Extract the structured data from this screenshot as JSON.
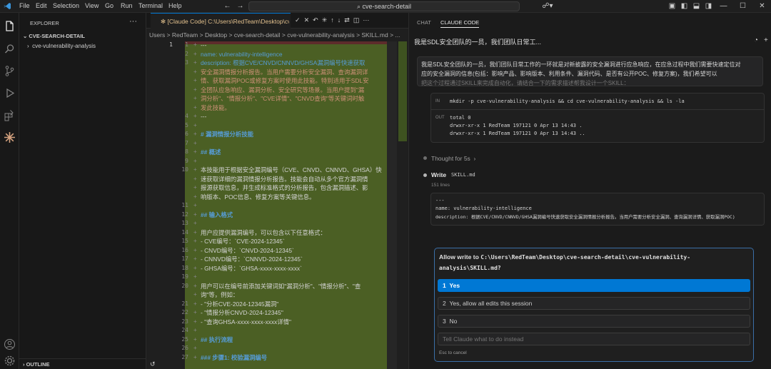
{
  "titlebar": {
    "menus": [
      "File",
      "Edit",
      "Selection",
      "View",
      "Go",
      "Run",
      "Terminal",
      "Help"
    ],
    "search": "cve-search-detail"
  },
  "sidebar": {
    "header": "EXPLORER",
    "root": "CVE-SEARCH-DETAIL",
    "folder": "cve-vulnerability-analysis",
    "outline": "OUTLINE"
  },
  "editor": {
    "tab_title": "✻ [Claude Code] C:\\Users\\RedTeam\\Desktop\\cve",
    "breadcrumb": "Users > RedTeam > Desktop > cve-search-detail > cve-vulnerability-analysis > SKILL.md > ...",
    "lines": [
      {
        "old": "1",
        "new": "1",
        "cls": "dash",
        "text": "---"
      },
      {
        "old": "",
        "new": "2",
        "cls": "meta",
        "text": "name: vulnerability-intelligence"
      },
      {
        "old": "",
        "new": "3",
        "cls": "meta",
        "text": "description: 根据CVE/CNVD/CNNVD/GHSA漏洞编号快速获取"
      },
      {
        "old": "",
        "new": "",
        "cls": "val",
        "text": "安全漏洞情报分析报告。当用户需要分析安全漏洞、查询漏洞详"
      },
      {
        "old": "",
        "new": "",
        "cls": "val",
        "text": "情、获取漏洞POC或修复方案时使用此技能。特别适用于SDL安"
      },
      {
        "old": "",
        "new": "",
        "cls": "val",
        "text": "全团队应急响应、漏洞分析、安全研究等场景。当用户提到\"漏"
      },
      {
        "old": "",
        "new": "",
        "cls": "val",
        "text": "洞分析\"、\"情报分析\"、\"CVE详情\"、\"CNVD查询\"等关键词时触"
      },
      {
        "old": "",
        "new": "",
        "cls": "val",
        "text": "发此技能。"
      },
      {
        "old": "",
        "new": "4",
        "cls": "dash",
        "text": "---"
      },
      {
        "old": "",
        "new": "5",
        "cls": "txt",
        "text": ""
      },
      {
        "old": "",
        "new": "6",
        "cls": "head",
        "text": "# 漏洞情报分析技能"
      },
      {
        "old": "",
        "new": "7",
        "cls": "txt",
        "text": ""
      },
      {
        "old": "",
        "new": "8",
        "cls": "head",
        "text": "## 概述"
      },
      {
        "old": "",
        "new": "9",
        "cls": "txt",
        "text": ""
      },
      {
        "old": "",
        "new": "10",
        "cls": "txt",
        "text": "本技能用于根据安全漏洞编号（CVE、CNVD、CNNVD、GHSA）快"
      },
      {
        "old": "",
        "new": "",
        "cls": "txt",
        "text": "速获取详细的漏洞情报分析报告。技能会自动从多个官方漏洞情"
      },
      {
        "old": "",
        "new": "",
        "cls": "txt",
        "text": "报源获取信息，并生成标准格式的分析报告，包含漏洞描述、影"
      },
      {
        "old": "",
        "new": "",
        "cls": "txt",
        "text": "响版本、POC信息、修复方案等关键信息。"
      },
      {
        "old": "",
        "new": "11",
        "cls": "txt",
        "text": ""
      },
      {
        "old": "",
        "new": "12",
        "cls": "head",
        "text": "## 输入格式"
      },
      {
        "old": "",
        "new": "13",
        "cls": "txt",
        "text": ""
      },
      {
        "old": "",
        "new": "14",
        "cls": "txt",
        "text": "用户应提供漏洞编号，可以包含以下任意格式："
      },
      {
        "old": "",
        "new": "15",
        "cls": "txt",
        "text": "- CVE编号：`CVE-2024-12345`"
      },
      {
        "old": "",
        "new": "16",
        "cls": "txt",
        "text": "- CNVD编号：`CNVD-2024-12345`"
      },
      {
        "old": "",
        "new": "17",
        "cls": "txt",
        "text": "- CNNVD编号：`CNNVD-2024-12345`"
      },
      {
        "old": "",
        "new": "18",
        "cls": "txt",
        "text": "- GHSA编号：`GHSA-xxxx-xxxx-xxxx`"
      },
      {
        "old": "",
        "new": "19",
        "cls": "txt",
        "text": ""
      },
      {
        "old": "",
        "new": "20",
        "cls": "txt",
        "text": "用户可以在编号前添加关键词如\"漏洞分析\"、\"情报分析\"、\"查"
      },
      {
        "old": "",
        "new": "",
        "cls": "txt",
        "text": "询\"等，例如："
      },
      {
        "old": "",
        "new": "21",
        "cls": "txt",
        "text": "- \"分析CVE-2024-12345漏洞\""
      },
      {
        "old": "",
        "new": "22",
        "cls": "txt",
        "text": "- \"情报分析CNVD-2024-12345\""
      },
      {
        "old": "",
        "new": "23",
        "cls": "txt",
        "text": "- \"查询GHSA-xxxx-xxxx-xxxx详情\""
      },
      {
        "old": "",
        "new": "24",
        "cls": "txt",
        "text": ""
      },
      {
        "old": "",
        "new": "25",
        "cls": "head",
        "text": "## 执行流程"
      },
      {
        "old": "",
        "new": "26",
        "cls": "txt",
        "text": ""
      },
      {
        "old": "",
        "new": "27",
        "cls": "head",
        "text": "### 步骤1: 校验漏洞编号"
      }
    ]
  },
  "panel": {
    "tab_chat": "CHAT",
    "tab_claude": "CLAUDE CODE",
    "title": "我是SDL安全团队的一员，我们团队日常工...",
    "user_msg_1": "我是SDL安全团队的一员，我们团队日常工作的一环就是对新披露的安全漏洞进行应急响应，在应急过程中我们需要快速定位对",
    "user_msg_2": "应的安全漏洞的信息(包括：影响产品、影响版本、利用条件、漏洞代码、是否有公开POC、修复方案)，我们希望可以",
    "user_msg_3": "把这个过程通过SKILL来完成自动化，请结合一下的需求描述帮我设计一个SKILL：",
    "in_label": "IN",
    "in_cmd": "mkdir -p cve-vulnerability-analysis && cd cve-vulnerability-analysis && ls -la",
    "out_label": "OUT",
    "out_1": "total 0",
    "out_2": "drwxr-xr-x 1 RedTeam 197121 0 Apr 13 14:43 .",
    "out_3": "drwxr-xr-x 1 RedTeam 197121 0 Apr 13 14:43 ..",
    "thought": "Thought for 5s",
    "write_label": "Write",
    "write_file": "SKILL.md",
    "write_lines": "151 lines",
    "preview_1": "---",
    "preview_2": "name: vulnerability-intelligence",
    "preview_3": "description: 根据CVE/CNVD/CNNVD/GHSA漏洞编号快速获取安全漏洞情报分析报告。当用户需要分析安全漏洞、查询漏洞详情、获取漏洞POC)",
    "allow_prefix": "Allow write to",
    "allow_path_1": "C:\\Users\\RedTeam\\Desktop\\cve-search-detail\\cve-vulnerability-",
    "allow_path_2": "analysis\\SKILL.md?",
    "opt1_num": "1",
    "opt1": "Yes",
    "opt2_num": "2",
    "opt2": "Yes, allow all edits this session",
    "opt3_num": "3",
    "opt3": "No",
    "input_placeholder": "Tell Claude what to do instead",
    "esc_hint": "Esc to cancel"
  },
  "colors": {
    "accent": "#0078d4",
    "diff_added": "#4b5f24",
    "modified": "#e2c08d"
  }
}
